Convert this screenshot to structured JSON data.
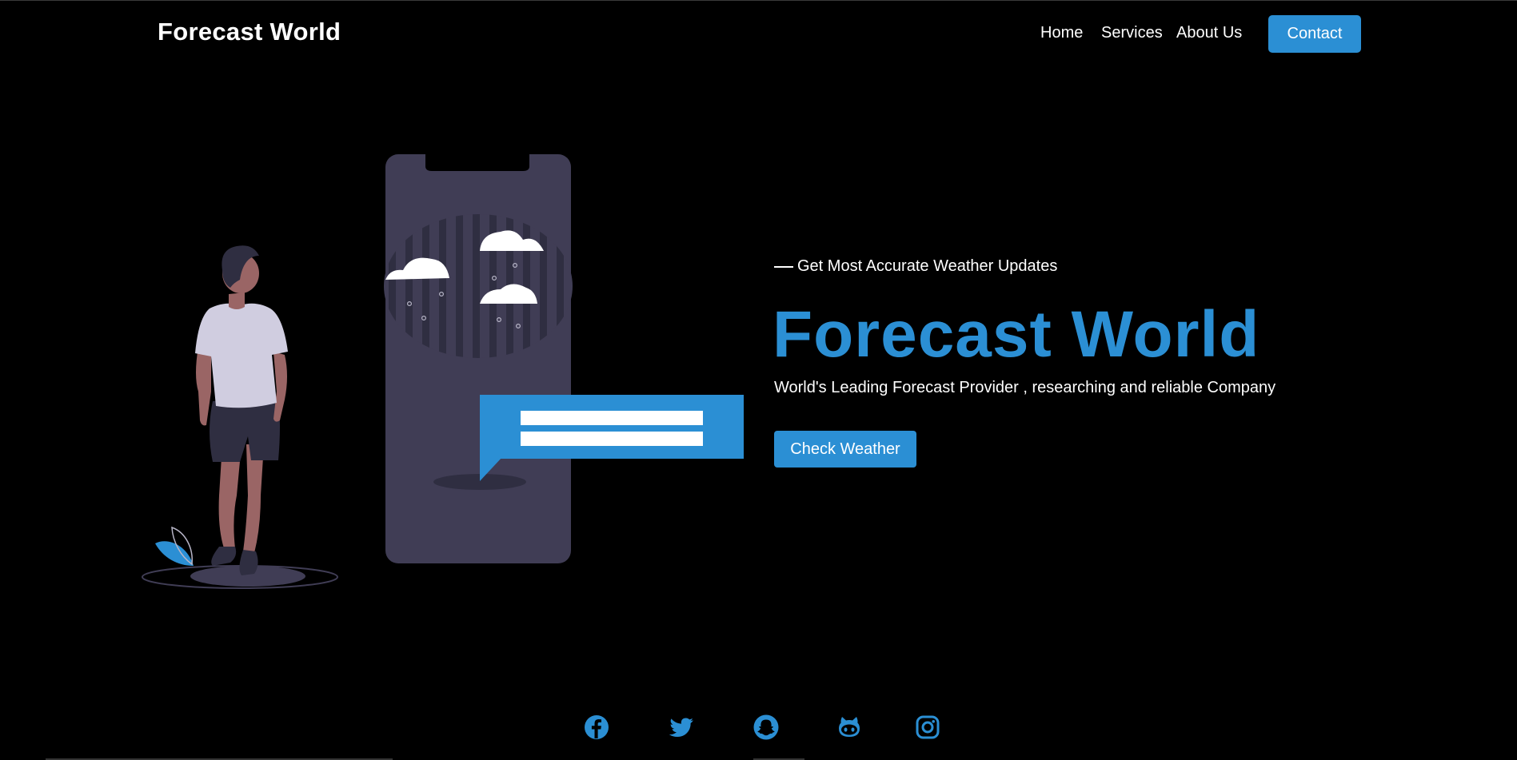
{
  "header": {
    "brand": "Forecast World",
    "nav": {
      "home": "Home",
      "services": "Services",
      "about": "About Us"
    },
    "contact_label": "Contact"
  },
  "hero": {
    "eyebrow": "Get Most Accurate Weather Updates",
    "title": "Forecast World",
    "description": "World's Leading Forecast Provider , researching and reliable Company",
    "cta_label": "Check Weather"
  },
  "socials": [
    {
      "icon": "facebook-icon"
    },
    {
      "icon": "twitter-icon"
    },
    {
      "icon": "snapchat-icon"
    },
    {
      "icon": "github-icon"
    },
    {
      "icon": "instagram-icon"
    }
  ],
  "colors": {
    "background": "#000000",
    "accent": "#2b8fd4",
    "phone": "#403d55",
    "shirt": "#d0cde0",
    "skin": "#9a6565",
    "shorts": "#2f2e41"
  }
}
